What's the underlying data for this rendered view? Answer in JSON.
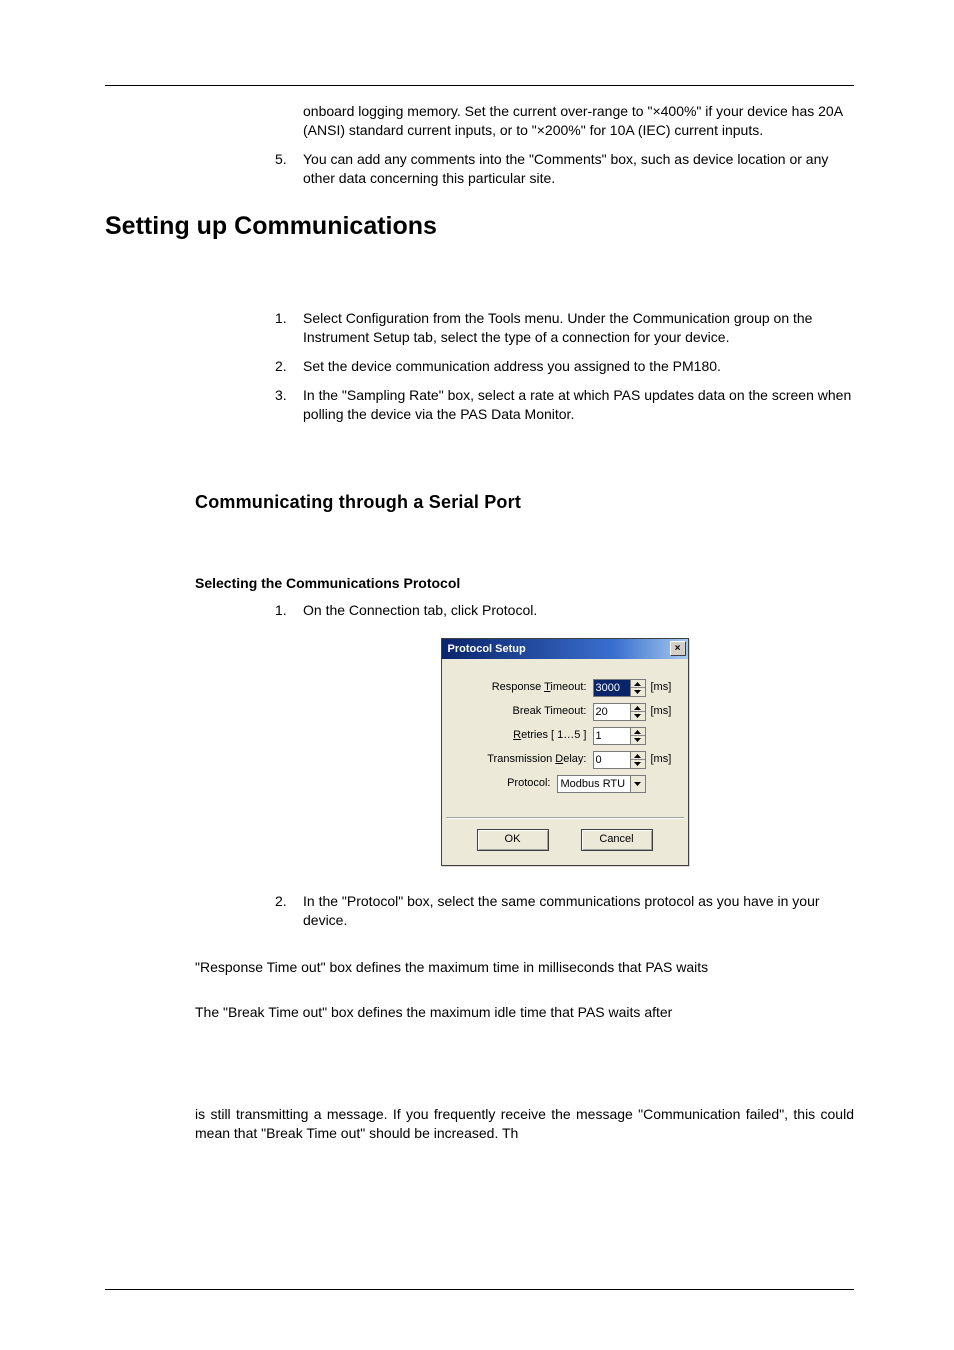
{
  "intro": {
    "item4_continuation": "onboard logging memory. Set the current over-range to \"×400%\" if your device has 20A (ANSI) standard current inputs, or to \"×200%\" for 10A (IEC) current inputs.",
    "item5_num": "5.",
    "item5_text": "You can add any comments into the \"Comments\" box, such as device location or any other data concerning this particular site."
  },
  "heading_main": "Setting up Communications",
  "setup_list": {
    "n1": "1.",
    "t1": "Select Configuration from the Tools menu. Under the Communication group on the Instrument Setup tab, select the type of a connection for your device.",
    "n2": "2.",
    "t2": "Set the device communication address you assigned to the PM180.",
    "n3": "3.",
    "t3": "In the \"Sampling Rate\" box, select a rate at which PAS updates data on the screen when polling the device via the PAS Data Monitor."
  },
  "heading_serial": "Communicating through a Serial Port",
  "heading_proto": "Selecting the Communications Protocol",
  "proto_list": {
    "n1": "1.",
    "t1": "On the Connection tab, click Protocol.",
    "n2": "2.",
    "t2": "In the \"Protocol\" box, select the same communications protocol as you have in your device."
  },
  "para1": "\"Response Time out\" box defines the maximum time in milliseconds that PAS waits",
  "para2": "The \"Break Time out\" box defines the maximum idle time that PAS waits after",
  "para3": "is still transmitting a message. If you frequently receive the message \"Communication failed\", this could mean that \"Break Time out\" should be increased. Th",
  "dialog": {
    "title": "Protocol Setup",
    "close": "×",
    "labels": {
      "response": "Response Timeout:",
      "response_ul": "T",
      "break": "Break Timeout:",
      "retries_pre": "Retries [ 1…5 ]",
      "retries_ul": "R",
      "delay": "Transmission Delay:",
      "delay_ul": "D",
      "protocol": "Protocol:"
    },
    "values": {
      "response": "3000",
      "break": "20",
      "retries": "1",
      "delay": "0",
      "protocol": "Modbus RTU"
    },
    "unit_ms": "[ms]",
    "ok": "OK",
    "cancel": "Cancel"
  }
}
